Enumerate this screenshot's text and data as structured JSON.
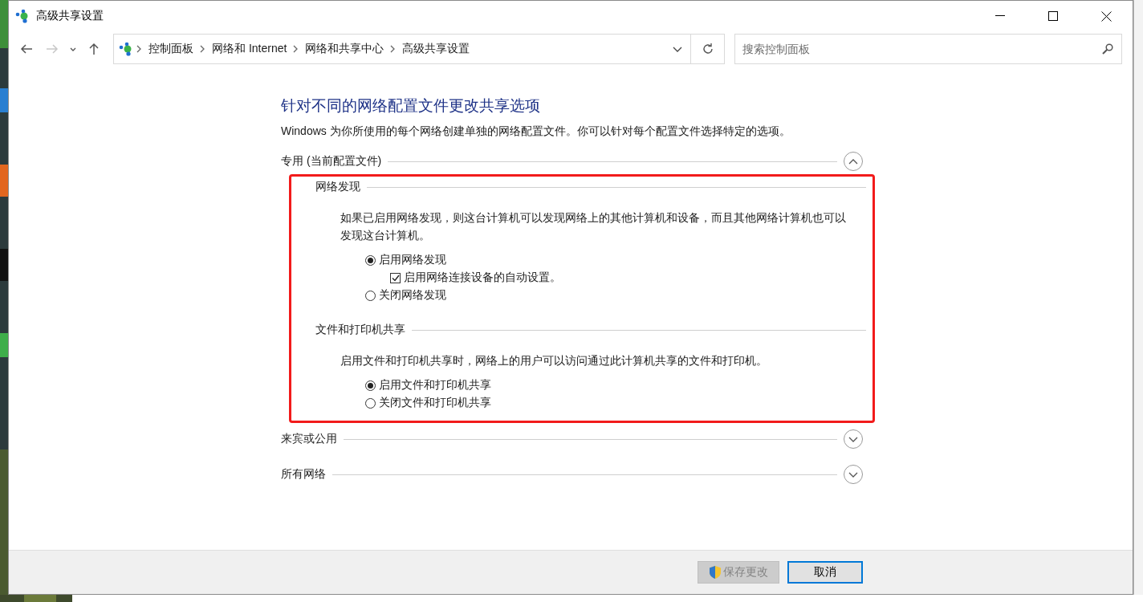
{
  "window": {
    "title": "高级共享设置"
  },
  "navigation": {
    "back_disabled": false,
    "forward_disabled": true
  },
  "address_bar": {
    "crumbs": [
      "控制面板",
      "网络和 Internet",
      "网络和共享中心",
      "高级共享设置"
    ]
  },
  "search": {
    "placeholder": "搜索控制面板"
  },
  "heading": "针对不同的网络配置文件更改共享选项",
  "intro": "Windows 为你所使用的每个网络创建单独的网络配置文件。你可以针对每个配置文件选择特定的选项。",
  "profiles": [
    {
      "title": "专用 (当前配置文件)",
      "expanded": true,
      "highlighted": true,
      "groups": [
        {
          "title": "网络发现",
          "description": "如果已启用网络发现，则这台计算机可以发现网络上的其他计算机和设备，而且其他网络计算机也可以发现这台计算机。",
          "options": [
            {
              "kind": "radio",
              "label": "启用网络发现",
              "selected": true,
              "children": [
                {
                  "kind": "checkbox",
                  "label": "启用网络连接设备的自动设置。",
                  "checked": true
                }
              ]
            },
            {
              "kind": "radio",
              "label": "关闭网络发现",
              "selected": false
            }
          ]
        },
        {
          "title": "文件和打印机共享",
          "description": "启用文件和打印机共享时，网络上的用户可以访问通过此计算机共享的文件和打印机。",
          "options": [
            {
              "kind": "radio",
              "label": "启用文件和打印机共享",
              "selected": true
            },
            {
              "kind": "radio",
              "label": "关闭文件和打印机共享",
              "selected": false
            }
          ]
        }
      ]
    },
    {
      "title": "来宾或公用",
      "expanded": false
    },
    {
      "title": "所有网络",
      "expanded": false
    }
  ],
  "buttons": [
    {
      "kind": "shield",
      "label": "保存更改",
      "disabled": true,
      "focused": false
    },
    {
      "kind": "plain",
      "label": "取消",
      "disabled": false,
      "focused": true
    }
  ]
}
